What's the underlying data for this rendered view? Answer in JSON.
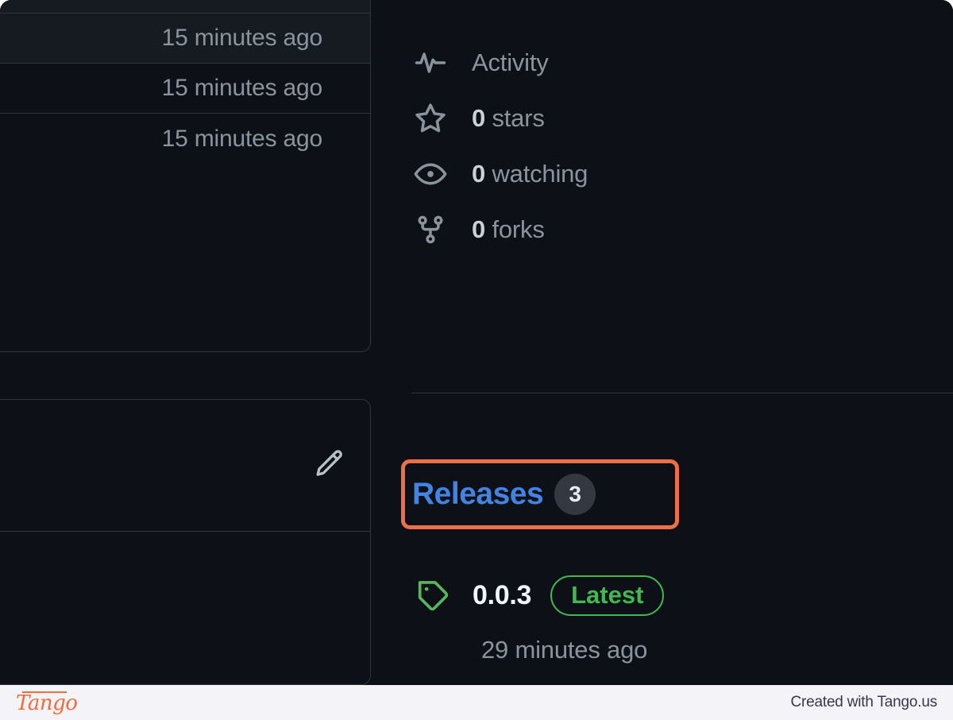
{
  "window": {
    "background": "#0d1117",
    "border_color": "#30363d"
  },
  "file_list": {
    "rows": [
      {
        "time": ""
      },
      {
        "time": "15 minutes ago"
      },
      {
        "time": "15 minutes ago"
      },
      {
        "time": "15 minutes ago"
      }
    ]
  },
  "readme_card": {
    "edit_icon": "pencil-icon"
  },
  "sidebar": {
    "stats": [
      {
        "icon": "pulse-icon",
        "value": "",
        "label": "Activity"
      },
      {
        "icon": "star-icon",
        "value": "0",
        "label": "stars"
      },
      {
        "icon": "eye-icon",
        "value": "0",
        "label": "watching"
      },
      {
        "icon": "fork-icon",
        "value": "0",
        "label": "forks"
      }
    ]
  },
  "releases": {
    "label": "Releases",
    "count": "3",
    "link_color": "#4184e4",
    "highlight_color": "#ef6e43",
    "latest": {
      "icon": "tag-icon",
      "version": "0.0.3",
      "badge": "Latest",
      "badge_color": "#3fb950",
      "time": "29 minutes ago"
    }
  },
  "footer": {
    "logo": "Tango",
    "credit": "Created with Tango.us",
    "logo_color": "#f26b3a",
    "background": "#f4f3f7"
  }
}
